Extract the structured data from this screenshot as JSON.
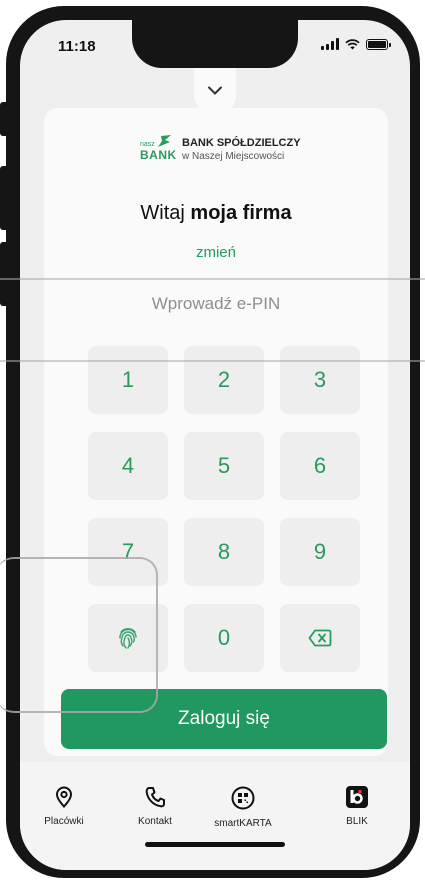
{
  "status_bar": {
    "time": "11:18"
  },
  "bank": {
    "logo_small": "nasz",
    "logo_big": "BANK",
    "name_line1": "BANK SPÓŁDZIELCZY",
    "name_line2": "w Naszej Miejscowości"
  },
  "greeting": {
    "prefix": "Witaj",
    "name": "moja firma"
  },
  "change_link": "zmień",
  "pin_hint": "Wprowadź e-PIN",
  "keypad": [
    "1",
    "2",
    "3",
    "4",
    "5",
    "6",
    "7",
    "8",
    "9",
    "0"
  ],
  "login_button": "Zaloguj się",
  "bottom_nav": [
    {
      "label": "Placówki",
      "icon": "location-pin-icon"
    },
    {
      "label": "Kontakt",
      "icon": "phone-icon"
    },
    {
      "label": "smartKARTA",
      "icon": "qr-code-icon"
    },
    {
      "label": "BLIK",
      "icon": "blik-icon"
    }
  ],
  "colors": {
    "accent": "#20985f",
    "key_text": "#2a9a5e",
    "key_bg": "#eeeeee"
  }
}
